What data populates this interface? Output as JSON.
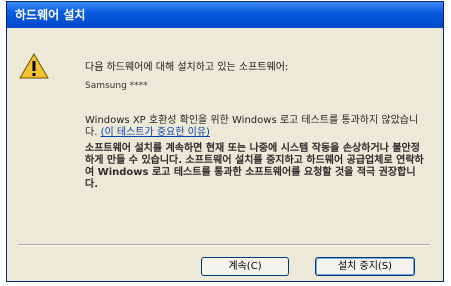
{
  "window": {
    "title": "하드웨어 설치"
  },
  "message": {
    "heading": "다음 하드웨어에 대해 설치하고 있는 소프트웨어:",
    "device": "Samsung ****",
    "paragraph1": "Windows XP 호환성 확인을 위한 Windows 로고 테스트를 통과하지 않았습니다.",
    "paragraph1_link": "(이 테스트가 중요한 이유)",
    "paragraph2": "소프트웨어 설치를 계속하면 현재 또는 나중에 시스템 작동을 손상하거나 불안정하게 만들 수 있습니다. 소프트웨어 설치를 중지하고 하드웨어 공급업체로 연락하여 Windows 로고 테스트를 통과한 소프트웨어를 요청할 것을 적극 권장합니다."
  },
  "buttons": {
    "continue_label": "계속(C)",
    "stop_label": "설치 중지(S)"
  },
  "icons": {
    "warning": "warning-triangle-icon"
  },
  "colors": {
    "titlebar": "#0A5BE0",
    "dialog_bg": "#ECE9D8",
    "warning": "#F4C430"
  }
}
